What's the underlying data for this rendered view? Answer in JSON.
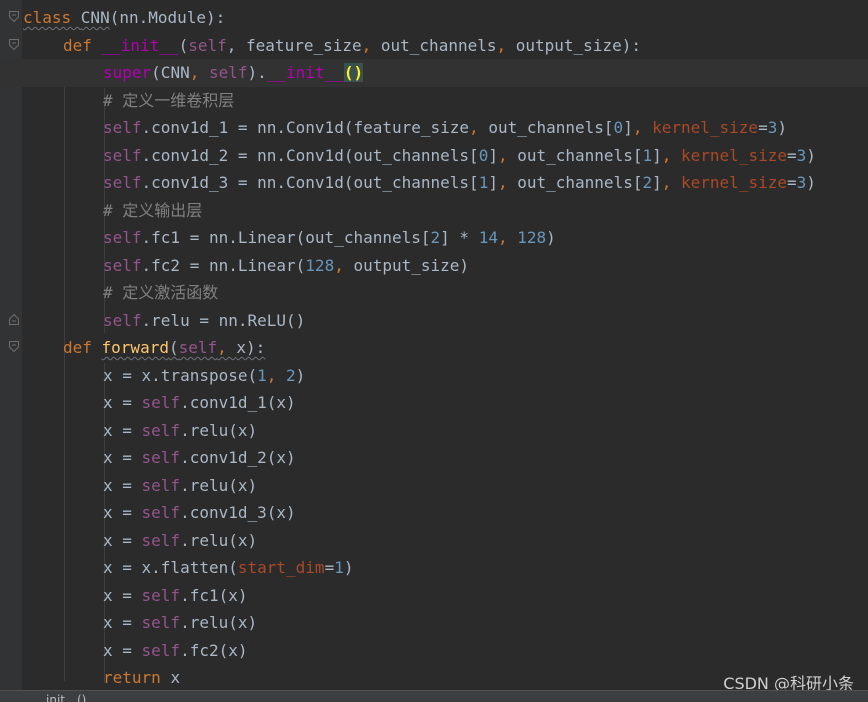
{
  "lines": [
    {
      "indent": 0,
      "tokens": [
        {
          "t": "class ",
          "c": "kw squig"
        },
        {
          "t": "CNN",
          "c": "plain squig"
        },
        {
          "t": "(nn.Module):",
          "c": "plain"
        }
      ]
    },
    {
      "indent": 1,
      "tokens": [
        {
          "t": "def ",
          "c": "kw"
        },
        {
          "t": "__init__",
          "c": "magic"
        },
        {
          "t": "(",
          "c": "plain"
        },
        {
          "t": "self",
          "c": "self"
        },
        {
          "t": ", feature_size",
          "c": "plain"
        },
        {
          "t": ", ",
          "c": "kw"
        },
        {
          "t": "out_channels",
          "c": "plain"
        },
        {
          "t": ", ",
          "c": "kw"
        },
        {
          "t": "output_size):",
          "c": "plain"
        }
      ]
    },
    {
      "indent": 2,
      "current": true,
      "tokens": [
        {
          "t": "super",
          "c": "magic"
        },
        {
          "t": "(CNN",
          "c": "plain"
        },
        {
          "t": ", ",
          "c": "kw"
        },
        {
          "t": "self",
          "c": "self"
        },
        {
          "t": ").",
          "c": "plain"
        },
        {
          "t": "__init__",
          "c": "magic"
        },
        {
          "t": "()",
          "c": "caret-box"
        }
      ]
    },
    {
      "indent": 2,
      "tokens": [
        {
          "t": "# 定义一维卷积层",
          "c": "cm"
        }
      ]
    },
    {
      "indent": 2,
      "tokens": [
        {
          "t": "self",
          "c": "self"
        },
        {
          "t": ".conv1d_1 = nn.Conv1d(feature_size",
          "c": "plain"
        },
        {
          "t": ", ",
          "c": "kw"
        },
        {
          "t": "out_channels[",
          "c": "plain"
        },
        {
          "t": "0",
          "c": "num"
        },
        {
          "t": "]",
          "c": "plain"
        },
        {
          "t": ", ",
          "c": "kw"
        },
        {
          "t": "kernel_size",
          "c": "param"
        },
        {
          "t": "=",
          "c": "plain"
        },
        {
          "t": "3",
          "c": "num"
        },
        {
          "t": ")",
          "c": "plain"
        }
      ]
    },
    {
      "indent": 2,
      "tokens": [
        {
          "t": "self",
          "c": "self"
        },
        {
          "t": ".conv1d_2 = nn.Conv1d(out_channels[",
          "c": "plain"
        },
        {
          "t": "0",
          "c": "num"
        },
        {
          "t": "]",
          "c": "plain"
        },
        {
          "t": ", ",
          "c": "kw"
        },
        {
          "t": "out_channels[",
          "c": "plain"
        },
        {
          "t": "1",
          "c": "num"
        },
        {
          "t": "]",
          "c": "plain"
        },
        {
          "t": ", ",
          "c": "kw"
        },
        {
          "t": "kernel_size",
          "c": "param"
        },
        {
          "t": "=",
          "c": "plain"
        },
        {
          "t": "3",
          "c": "num"
        },
        {
          "t": ")",
          "c": "plain"
        }
      ]
    },
    {
      "indent": 2,
      "tokens": [
        {
          "t": "self",
          "c": "self"
        },
        {
          "t": ".conv1d_3 = nn.Conv1d(out_channels[",
          "c": "plain"
        },
        {
          "t": "1",
          "c": "num"
        },
        {
          "t": "]",
          "c": "plain"
        },
        {
          "t": ", ",
          "c": "kw"
        },
        {
          "t": "out_channels[",
          "c": "plain"
        },
        {
          "t": "2",
          "c": "num"
        },
        {
          "t": "]",
          "c": "plain"
        },
        {
          "t": ", ",
          "c": "kw"
        },
        {
          "t": "kernel_size",
          "c": "param"
        },
        {
          "t": "=",
          "c": "plain"
        },
        {
          "t": "3",
          "c": "num"
        },
        {
          "t": ")",
          "c": "plain"
        }
      ]
    },
    {
      "indent": 2,
      "tokens": [
        {
          "t": "# 定义输出层",
          "c": "cm"
        }
      ]
    },
    {
      "indent": 2,
      "tokens": [
        {
          "t": "self",
          "c": "self"
        },
        {
          "t": ".fc1 = nn.Linear(out_channels[",
          "c": "plain"
        },
        {
          "t": "2",
          "c": "num"
        },
        {
          "t": "] * ",
          "c": "plain"
        },
        {
          "t": "14",
          "c": "num"
        },
        {
          "t": ", ",
          "c": "kw"
        },
        {
          "t": "128",
          "c": "num"
        },
        {
          "t": ")",
          "c": "plain"
        }
      ]
    },
    {
      "indent": 2,
      "tokens": [
        {
          "t": "self",
          "c": "self"
        },
        {
          "t": ".fc2 = nn.Linear(",
          "c": "plain"
        },
        {
          "t": "128",
          "c": "num"
        },
        {
          "t": ", ",
          "c": "kw"
        },
        {
          "t": "output_size)",
          "c": "plain"
        }
      ]
    },
    {
      "indent": 2,
      "tokens": [
        {
          "t": "# 定义激活函数",
          "c": "cm"
        }
      ]
    },
    {
      "indent": 2,
      "tokens": [
        {
          "t": "self",
          "c": "self"
        },
        {
          "t": ".relu = nn.ReLU()",
          "c": "plain"
        }
      ]
    },
    {
      "indent": 1,
      "tokens": [
        {
          "t": "def ",
          "c": "kw"
        },
        {
          "t": "forward",
          "c": "fn squig"
        },
        {
          "t": "(",
          "c": "plain squig"
        },
        {
          "t": "self",
          "c": "self squig"
        },
        {
          "t": ", ",
          "c": "kw squig"
        },
        {
          "t": "x):",
          "c": "plain squig"
        }
      ]
    },
    {
      "indent": 2,
      "tokens": [
        {
          "t": "x = x.transpose(",
          "c": "plain"
        },
        {
          "t": "1",
          "c": "num"
        },
        {
          "t": ", ",
          "c": "kw"
        },
        {
          "t": "2",
          "c": "num"
        },
        {
          "t": ")",
          "c": "plain"
        }
      ]
    },
    {
      "indent": 2,
      "tokens": [
        {
          "t": "x = ",
          "c": "plain"
        },
        {
          "t": "self",
          "c": "self"
        },
        {
          "t": ".conv1d_1(x)",
          "c": "plain"
        }
      ]
    },
    {
      "indent": 2,
      "tokens": [
        {
          "t": "x = ",
          "c": "plain"
        },
        {
          "t": "self",
          "c": "self"
        },
        {
          "t": ".relu(x)",
          "c": "plain"
        }
      ]
    },
    {
      "indent": 2,
      "tokens": [
        {
          "t": "x = ",
          "c": "plain"
        },
        {
          "t": "self",
          "c": "self"
        },
        {
          "t": ".conv1d_2(x)",
          "c": "plain"
        }
      ]
    },
    {
      "indent": 2,
      "tokens": [
        {
          "t": "x = ",
          "c": "plain"
        },
        {
          "t": "self",
          "c": "self"
        },
        {
          "t": ".relu(x)",
          "c": "plain"
        }
      ]
    },
    {
      "indent": 2,
      "tokens": [
        {
          "t": "x = ",
          "c": "plain"
        },
        {
          "t": "self",
          "c": "self"
        },
        {
          "t": ".conv1d_3(x)",
          "c": "plain"
        }
      ]
    },
    {
      "indent": 2,
      "tokens": [
        {
          "t": "x = ",
          "c": "plain"
        },
        {
          "t": "self",
          "c": "self"
        },
        {
          "t": ".relu(x)",
          "c": "plain"
        }
      ]
    },
    {
      "indent": 2,
      "tokens": [
        {
          "t": "x = x.flatten(",
          "c": "plain"
        },
        {
          "t": "start_dim",
          "c": "param"
        },
        {
          "t": "=",
          "c": "plain"
        },
        {
          "t": "1",
          "c": "num"
        },
        {
          "t": ")",
          "c": "plain"
        }
      ]
    },
    {
      "indent": 2,
      "tokens": [
        {
          "t": "x = ",
          "c": "plain"
        },
        {
          "t": "self",
          "c": "self"
        },
        {
          "t": ".fc1(x)",
          "c": "plain"
        }
      ]
    },
    {
      "indent": 2,
      "tokens": [
        {
          "t": "x = ",
          "c": "plain"
        },
        {
          "t": "self",
          "c": "self"
        },
        {
          "t": ".relu(x)",
          "c": "plain"
        }
      ]
    },
    {
      "indent": 2,
      "tokens": [
        {
          "t": "x = ",
          "c": "plain"
        },
        {
          "t": "self",
          "c": "self"
        },
        {
          "t": ".fc2(x)",
          "c": "plain"
        }
      ]
    },
    {
      "indent": 2,
      "tokens": [
        {
          "t": "return ",
          "c": "kw"
        },
        {
          "t": "x",
          "c": "plain"
        }
      ]
    }
  ],
  "statusbar": {
    "breadcrumb": "__init__()"
  },
  "watermark": "CSDN @科研小条",
  "icons": [
    "fold-open-icon",
    "fold-end-icon"
  ],
  "colors": {
    "background": "#2b2b2b",
    "keyword": "#cc7832",
    "self": "#94558d",
    "number": "#6897bb",
    "comment": "#808080",
    "magic": "#b200b2",
    "param": "#aa4926",
    "function": "#ffc66d"
  }
}
